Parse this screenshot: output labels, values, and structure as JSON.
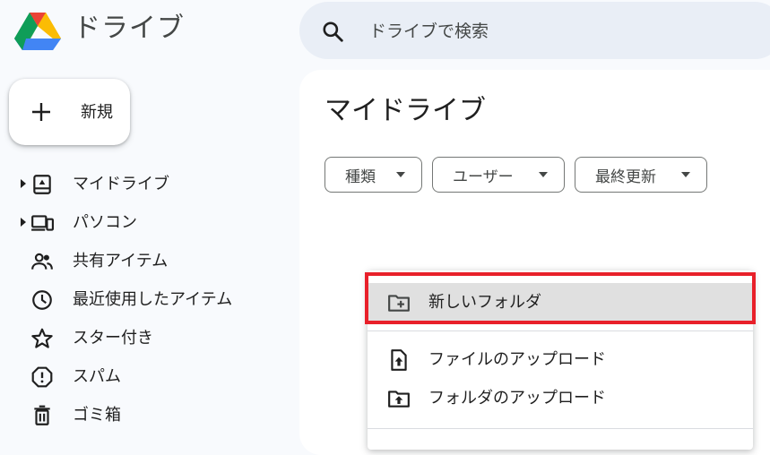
{
  "app": {
    "title": "ドライブ",
    "logo_icon": "google-drive-logo"
  },
  "search": {
    "placeholder": "ドライブで検索",
    "icon": "search-icon"
  },
  "new_button": {
    "label": "新規",
    "icon": "plus-icon"
  },
  "sidebar": {
    "items": [
      {
        "label": "マイドライブ",
        "icon": "my-drive-icon",
        "expandable": true
      },
      {
        "label": "パソコン",
        "icon": "computers-icon",
        "expandable": true
      },
      {
        "label": "共有アイテム",
        "icon": "shared-people-icon",
        "expandable": false
      },
      {
        "label": "最近使用したアイテム",
        "icon": "clock-icon",
        "expandable": false
      },
      {
        "label": "スター付き",
        "icon": "star-icon",
        "expandable": false
      },
      {
        "label": "スパム",
        "icon": "spam-icon",
        "expandable": false
      },
      {
        "label": "ゴミ箱",
        "icon": "trash-icon",
        "expandable": false
      }
    ]
  },
  "main": {
    "title": "マイドライブ",
    "filters": [
      {
        "label": "種類"
      },
      {
        "label": "ユーザー"
      },
      {
        "label": "最終更新"
      }
    ]
  },
  "context_menu": {
    "items": [
      {
        "label": "新しいフォルダ",
        "icon": "new-folder-icon",
        "highlighted": true
      },
      {
        "label": "ファイルのアップロード",
        "icon": "file-upload-icon",
        "highlighted": false
      },
      {
        "label": "フォルダのアップロード",
        "icon": "folder-upload-icon",
        "highlighted": false
      }
    ]
  },
  "colors": {
    "background": "#f8fafd",
    "search_bg": "#e9eef6",
    "annotation_red": "#e8202a",
    "menu_highlight": "#e0e0e0"
  }
}
